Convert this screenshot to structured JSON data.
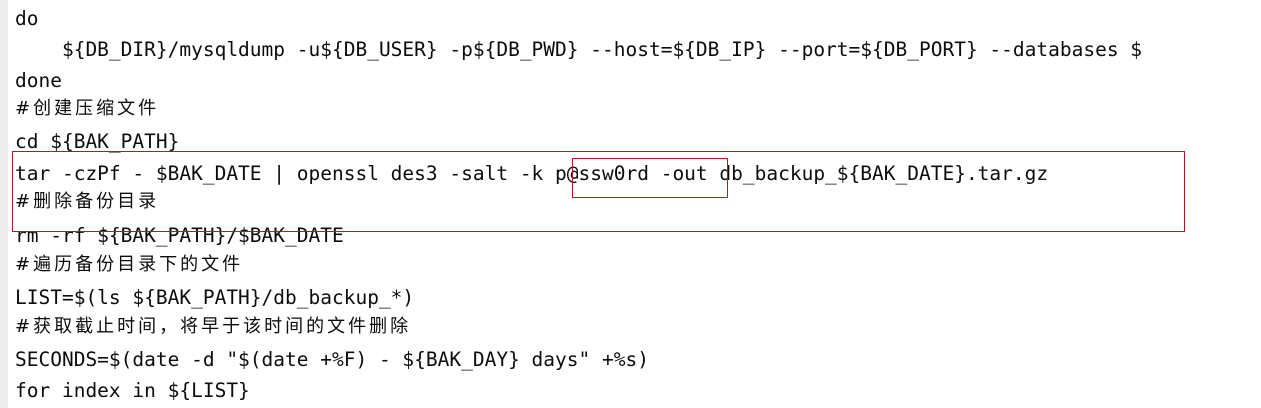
{
  "terminal": {
    "lines": [
      "do",
      "    ${DB_DIR}/mysqldump -u${DB_USER} -p${DB_PWD} --host=${DB_IP} --port=${DB_PORT} --databases $",
      "done",
      "#创建压缩文件",
      "cd ${BAK_PATH}",
      "tar -czPf - $BAK_DATE | openssl des3 -salt -k p@ssw0rd -out db_backup_${BAK_DATE}.tar.gz",
      "#删除备份目录",
      "rm -rf ${BAK_PATH}/$BAK_DATE",
      "#遍历备份目录下的文件",
      "LIST=$(ls ${BAK_PATH}/db_backup_*)",
      "#获取截止时间，将早于该时间的文件删除",
      "SECONDS=$(date -d \"$(date +%F) - ${BAK_DAY} days\" +%s)",
      "for index in ${LIST}"
    ]
  },
  "annotations": {
    "box_color": "#c0141c"
  }
}
